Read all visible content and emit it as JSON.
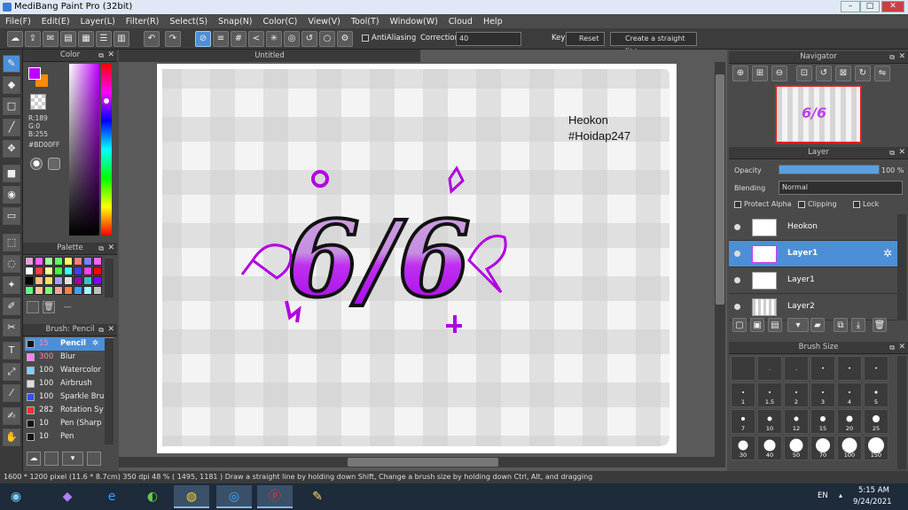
{
  "window": {
    "title": "MediBang Paint Pro (32bit)"
  },
  "menu": [
    "File(F)",
    "Edit(E)",
    "Layer(L)",
    "Filter(R)",
    "Select(S)",
    "Snap(N)",
    "Color(C)",
    "View(V)",
    "Tool(T)",
    "Window(W)",
    "Cloud",
    "Help"
  ],
  "toolbar": {
    "antialiasing_label": "AntiAliasing",
    "correction_label": "Correction",
    "correction_value": "40",
    "key_label": "Key",
    "reset_label": "Reset",
    "straight_line_label": "Create a straight line"
  },
  "color_panel": {
    "title": "Color",
    "r": "R:189",
    "g": "G:0",
    "b": "B:255",
    "hex": "#BD00FF",
    "fg_color": "#bd00ff",
    "bg_color": "#ff8c00"
  },
  "palette_panel": {
    "title": "Palette",
    "extra_label": "---",
    "swatches": [
      "#e0a0e0",
      "#ff60ff",
      "#a0ffa0",
      "#60ff60",
      "#ffff60",
      "#ff8080",
      "#8080ff",
      "#ff60ff",
      "#ffffff",
      "#ff4040",
      "#ffffa0",
      "#40ff40",
      "#40ffff",
      "#4040ff",
      "#ff40ff",
      "#ff0000",
      "#000000",
      "#ffc080",
      "#ffe060",
      "#a0a0ff",
      "#e0e0e0",
      "#a000a0",
      "#40c0c0",
      "#8000ff",
      "#60ff80",
      "#ffc0a0",
      "#80ff80",
      "#ffa0a0",
      "#ff8040",
      "#40a0ff",
      "#a0ffff",
      "#c0c0c0"
    ]
  },
  "brush_panel": {
    "title": "Brush: Pencil",
    "items": [
      {
        "size": "15",
        "name": "Pencil",
        "color": "#111111"
      },
      {
        "size": "300",
        "name": "Blur",
        "color": "#ff80ff"
      },
      {
        "size": "100",
        "name": "Watercolor",
        "color": "#80d0ff"
      },
      {
        "size": "100",
        "name": "Airbrush",
        "color": "#dddddd"
      },
      {
        "size": "100",
        "name": "Sparkle Bru",
        "color": "#3050ff"
      },
      {
        "size": "282",
        "name": "Rotation Sy",
        "color": "#ff3030"
      },
      {
        "size": "10",
        "name": "Pen (Sharp",
        "color": "#111111"
      },
      {
        "size": "10",
        "name": "Pen",
        "color": "#111111"
      }
    ]
  },
  "document": {
    "tab_title": "Untitled",
    "text_line1": "Heokon",
    "text_line2": "#Hoidap247",
    "art_text": "6/6"
  },
  "navigator": {
    "title": "Navigator"
  },
  "layer_panel": {
    "title": "Layer",
    "opacity_label": "Opacity",
    "opacity_value": "100 %",
    "opacity_fraction": 1.0,
    "blending_label": "Blending",
    "blending_value": "Normal",
    "protect_alpha_label": "Protect Alpha",
    "clipping_label": "Clipping",
    "lock_label": "Lock",
    "layers": [
      {
        "name": "Heokon"
      },
      {
        "name": "Layer1"
      },
      {
        "name": "Layer1"
      },
      {
        "name": "Layer2"
      }
    ]
  },
  "brush_size_panel": {
    "title": "Brush Size",
    "row0_labels": [
      "",
      ".",
      ".",
      "•",
      "•",
      "•"
    ],
    "sizes": [
      "1",
      "1.5",
      "2",
      "3",
      "4",
      "5",
      "7",
      "10",
      "12",
      "15",
      "20",
      "25",
      "30",
      "40",
      "50",
      "70",
      "100",
      "150"
    ]
  },
  "status": {
    "text": "1600 * 1200 pixel  (11.6 * 8.7cm)  350 dpi  48 %  ( 1495, 1181 )  Draw a straight line by holding down Shift, Change a brush size by holding down Ctrl, Alt, and dragging"
  },
  "taskbar": {
    "lang": "EN",
    "time": "5:15 AM",
    "date": "9/24/2021"
  }
}
